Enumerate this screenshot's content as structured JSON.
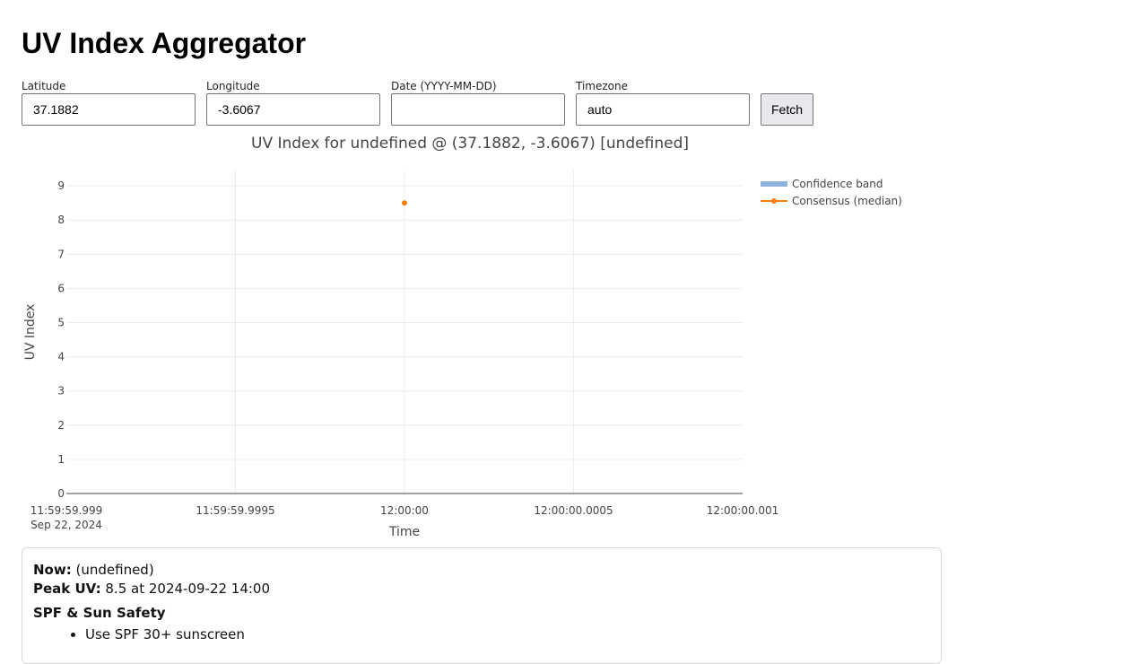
{
  "page_title": "UV Index Aggregator",
  "form": {
    "latitude": {
      "label": "Latitude",
      "value": "37.1882"
    },
    "longitude": {
      "label": "Longitude",
      "value": "-3.6067"
    },
    "date": {
      "label": "Date (YYYY-MM-DD)",
      "value": ""
    },
    "timezone": {
      "label": "Timezone",
      "value": "auto"
    },
    "fetch_label": "Fetch"
  },
  "chart_data": {
    "type": "line",
    "title": "UV Index for undefined @ (37.1882, -3.6067) [undefined]",
    "xlabel": "Time",
    "ylabel": "UV Index",
    "x_ticks": [
      "11:59:59.999",
      "11:59:59.9995",
      "12:00:00",
      "12:00:00.0005",
      "12:00:00.001"
    ],
    "x_tick_sub": "Sep 22, 2024",
    "y_ticks": [
      0,
      1,
      2,
      3,
      4,
      5,
      6,
      7,
      8,
      9
    ],
    "ylim": [
      0,
      9.45
    ],
    "xlim": [
      -0.001,
      0.001
    ],
    "grid": true,
    "legend_placement": "top-right",
    "legend": [
      "Confidence band",
      "Consensus (median)"
    ],
    "colors": {
      "band": "#8fb3d9",
      "median": "#ff7f0e"
    },
    "series": [
      {
        "name": "Consensus (median)",
        "x": [
          0
        ],
        "y": [
          8.5
        ]
      }
    ]
  },
  "summary": {
    "now_label": "Now:",
    "now_value": "(undefined)",
    "peak_label": "Peak UV:",
    "peak_value": "8.5 at 2024-09-22 14:00",
    "safety_heading": "SPF & Sun Safety",
    "tips": [
      "Use SPF 30+ sunscreen"
    ]
  }
}
